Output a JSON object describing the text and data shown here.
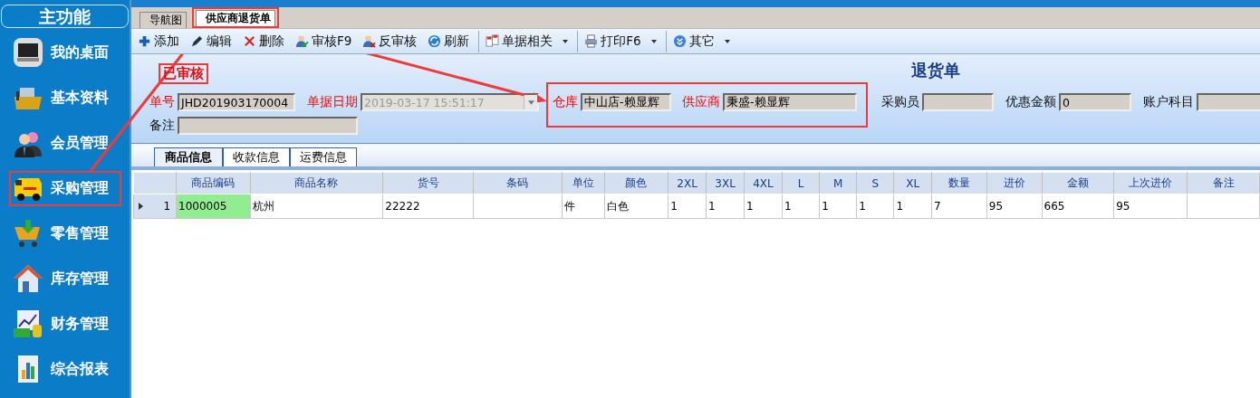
{
  "sidebar": {
    "title": "主功能",
    "items": [
      {
        "label": "我的桌面",
        "highlighted": false
      },
      {
        "label": "基本资料",
        "highlighted": false
      },
      {
        "label": "会员管理",
        "highlighted": false
      },
      {
        "label": "采购管理",
        "highlighted": true
      },
      {
        "label": "零售管理",
        "highlighted": false
      },
      {
        "label": "库存管理",
        "highlighted": false
      },
      {
        "label": "财务管理",
        "highlighted": false
      },
      {
        "label": "综合报表",
        "highlighted": false
      }
    ]
  },
  "tabs": [
    {
      "label": "导航图",
      "selected": false,
      "highlighted": false
    },
    {
      "label": "供应商退货单",
      "selected": true,
      "highlighted": true
    }
  ],
  "toolbar": [
    {
      "label": "添加",
      "dropdown": false,
      "separator_before": false
    },
    {
      "label": "编辑",
      "dropdown": false,
      "separator_before": false
    },
    {
      "label": "删除",
      "dropdown": false,
      "separator_before": false
    },
    {
      "label": "审核F9",
      "dropdown": false,
      "separator_before": false
    },
    {
      "label": "反审核",
      "dropdown": false,
      "separator_before": false
    },
    {
      "label": "刷新",
      "dropdown": false,
      "separator_before": false
    },
    {
      "label": "单据相关",
      "dropdown": true,
      "separator_before": true
    },
    {
      "label": "打印F6",
      "dropdown": true,
      "separator_before": true
    },
    {
      "label": "其它",
      "dropdown": true,
      "separator_before": true
    }
  ],
  "form": {
    "status": {
      "text": "已审核",
      "highlighted": true
    },
    "title": "退货单",
    "row_1": [
      {
        "label": "单号",
        "required": true,
        "value": "JHD201903170004",
        "disabled": false,
        "dropdown": false,
        "highlighted": false
      },
      {
        "label": "单据日期",
        "required": true,
        "value": "2019-03-17 15:51:17",
        "disabled": true,
        "dropdown": true,
        "highlighted": false
      },
      {
        "label": "仓库",
        "required": true,
        "value": "中山店-赖显辉",
        "disabled": false,
        "dropdown": false,
        "highlighted": true
      },
      {
        "label": "供应商",
        "required": true,
        "value": "秉盛-赖显辉",
        "disabled": false,
        "dropdown": false,
        "highlighted": true
      },
      {
        "label": "采购员",
        "required": false,
        "disabled": false,
        "dropdown": false,
        "highlighted": false
      },
      {
        "label": "优惠金额",
        "required": false,
        "value": "0",
        "disabled": false,
        "dropdown": false,
        "highlighted": false
      },
      {
        "label": "账户科目",
        "required": false,
        "disabled": false,
        "dropdown": false,
        "highlighted": false
      }
    ],
    "row_2": [
      {
        "label": "备注",
        "required": false
      }
    ]
  },
  "detail_tabs": [
    {
      "label": "商品信息",
      "selected": true
    },
    {
      "label": "收款信息",
      "selected": false
    },
    {
      "label": "运费信息",
      "selected": false
    }
  ],
  "table": {
    "columns": [
      "商品编码",
      "商品名称",
      "货号",
      "条码",
      "单位",
      "颜色",
      "2XL",
      "3XL",
      "4XL",
      "L",
      "M",
      "S",
      "XL",
      "数量",
      "进价",
      "金额",
      "上次进价",
      "备注"
    ],
    "rows": [
      {
        "number": "1",
        "current": true,
        "cells": [
          {
            "text": "1000005",
            "selected": true
          },
          {
            "text": "杭州",
            "selected": false
          },
          {
            "text": "22222",
            "selected": false
          },
          {
            "selected": false
          },
          {
            "text": "件",
            "selected": false
          },
          {
            "text": "白色",
            "selected": false
          },
          {
            "text": "1",
            "selected": false
          },
          {
            "text": "1",
            "selected": false
          },
          {
            "text": "1",
            "selected": false
          },
          {
            "text": "1",
            "selected": false
          },
          {
            "text": "1",
            "selected": false
          },
          {
            "text": "1",
            "selected": false
          },
          {
            "text": "1",
            "selected": false
          },
          {
            "text": "7",
            "selected": false
          },
          {
            "text": "95",
            "selected": false
          },
          {
            "text": "665",
            "selected": false
          },
          {
            "text": "95",
            "selected": false
          },
          {
            "selected": false
          }
        ]
      }
    ]
  }
}
